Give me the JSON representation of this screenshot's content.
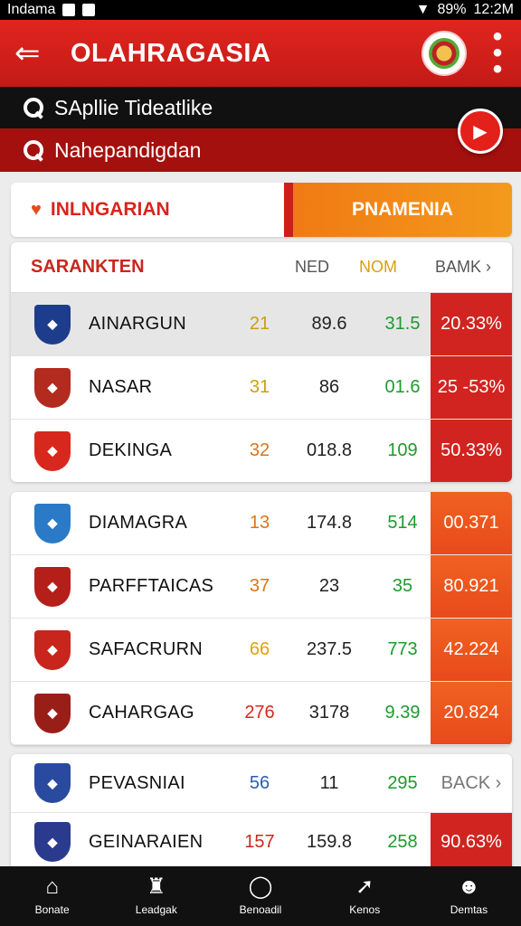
{
  "status": {
    "carrier": "Indama",
    "battery": "89%",
    "time": "12:2M"
  },
  "appbar": {
    "title": "OLAHRAGASIA"
  },
  "search1": {
    "text": "SApllie Tideatlike"
  },
  "search2": {
    "text": "Nahepandigdan"
  },
  "tabs": {
    "left": "INLNGARIAN",
    "right": "PNAMENIA"
  },
  "table": {
    "headers": {
      "name": "SARANKTEN",
      "c1": "NED",
      "c2": "NOM",
      "c3": "BAMK"
    }
  },
  "group1": [
    {
      "name": "AINARGUN",
      "a": "21",
      "b": "89.6",
      "c": "31.5",
      "d": "20.33%",
      "a_color": "#c8a010",
      "crest": "#1e3c8c",
      "d_style": "red"
    },
    {
      "name": "NASAR",
      "a": "31",
      "b": "86",
      "c": "01.6",
      "d": "25 -53%",
      "a_color": "#c8a010",
      "crest": "#b32a1e",
      "d_style": "red"
    },
    {
      "name": "DEKINGA",
      "a": "32",
      "b": "018.8",
      "c": "109",
      "d": "50.33%",
      "a_color": "#d8761a",
      "crest": "#d8281e",
      "d_style": "red"
    }
  ],
  "group2": [
    {
      "name": "DIAMAGRA",
      "a": "13",
      "b": "174.8",
      "c": "514",
      "d": "00.371",
      "a_color": "#d8761a",
      "crest": "#2a7ac8",
      "d_style": "orange"
    },
    {
      "name": "PARFFTAICAS",
      "a": "37",
      "b": "23",
      "c": "35",
      "d": "80.921",
      "a_color": "#d8761a",
      "crest": "#b51f1a",
      "d_style": "orange"
    },
    {
      "name": "SAFACRURN",
      "a": "66",
      "b": "237.5",
      "c": "773",
      "d": "42.224",
      "a_color": "#e0a010",
      "crest": "#c8261c",
      "d_style": "orange"
    },
    {
      "name": "CAHARGAG",
      "a": "276",
      "b": "3178",
      "c": "9.39",
      "d": "20.824",
      "a_color": "#d8281e",
      "crest": "#9a1e18",
      "d_style": "orange"
    }
  ],
  "group3": [
    {
      "name": "PEVASNIAI",
      "a": "56",
      "b": "11",
      "c": "295",
      "d": "BACK",
      "a_color": "#2a5fa8",
      "crest": "#2a4aa0",
      "d_style": "back"
    },
    {
      "name": "GEINARAIEN",
      "a": "157",
      "b": "159.8",
      "c": "258",
      "d": "90.63%",
      "a_color": "#c8281e",
      "crest": "#2a3a8c",
      "d_style": "red"
    }
  ],
  "bottomnav": [
    {
      "label": "Bonate",
      "glyph": "⌂"
    },
    {
      "label": "Leadgak",
      "glyph": "♜"
    },
    {
      "label": "Benoadil",
      "glyph": "◯"
    },
    {
      "label": "Kenos",
      "glyph": "➚"
    },
    {
      "label": "Demtas",
      "glyph": "☻"
    }
  ]
}
